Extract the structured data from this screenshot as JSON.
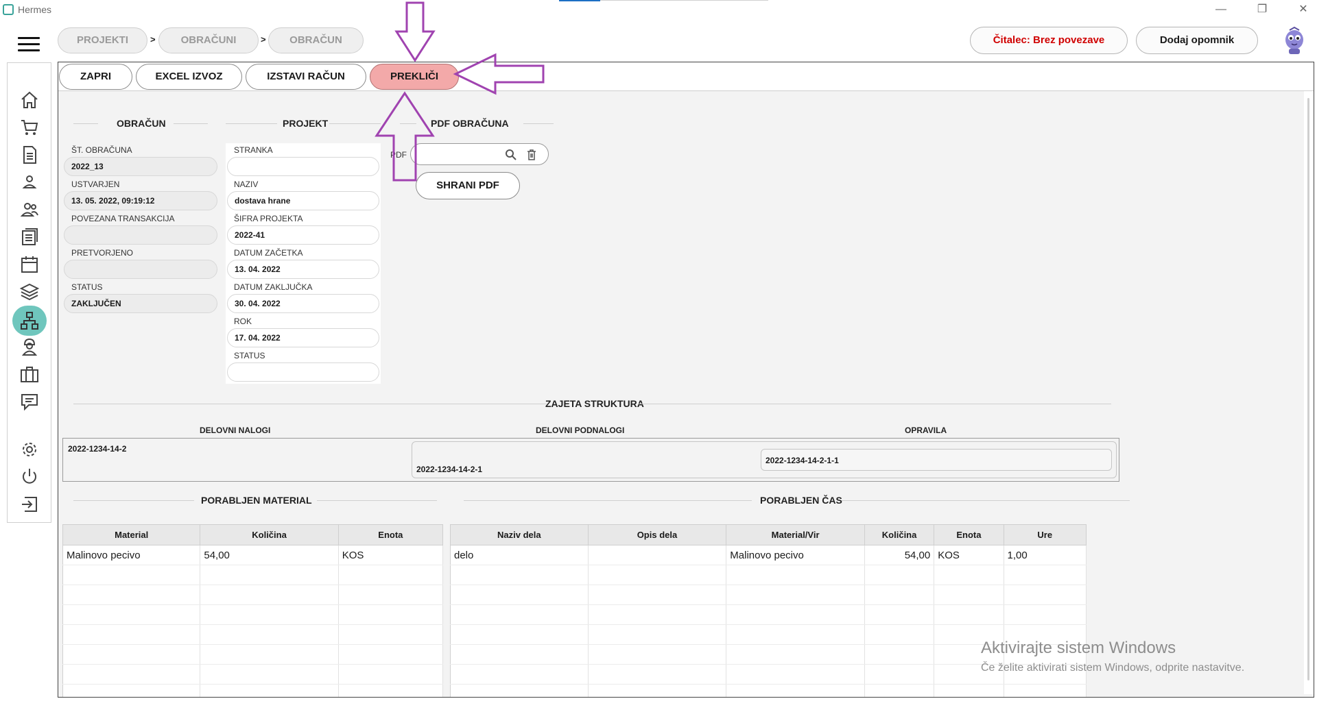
{
  "window": {
    "title": "Hermes",
    "minimize": "—",
    "maximize": "❐",
    "close": "✕"
  },
  "breadcrumbs": [
    "PROJEKTI",
    "OBRAČUNI",
    "OBRAČUN"
  ],
  "breadcrumb_sep": ">",
  "top_actions": {
    "reader_status": "Čitalec: Brez povezave",
    "add_reminder": "Dodaj opomnik"
  },
  "colors": {
    "accent": "#6fc6bd",
    "danger_button": "#f3a9a9",
    "reader_status_text": "#d00000",
    "annotation_arrow": "#a043b0"
  },
  "sidebar": {
    "items": [
      "home-icon",
      "cart-icon",
      "document-icon",
      "person-icon",
      "people-icon",
      "list-icon",
      "calendar-icon",
      "layers-icon",
      "hierarchy-icon",
      "worker-icon",
      "briefcase-icon",
      "chat-icon",
      "gear-icon",
      "power-icon",
      "logout-icon"
    ],
    "active": "hierarchy-icon"
  },
  "toolbar": {
    "close": "ZAPRI",
    "excel_export": "EXCEL IZVOZ",
    "issue_invoice": "IZSTAVI RAČUN",
    "cancel": "PREKLIČI"
  },
  "obracun": {
    "title": "OBRAČUN",
    "fields": [
      {
        "label": "ŠT. OBRAČUNA",
        "value": "2022_13"
      },
      {
        "label": "USTVARJEN",
        "value": "13. 05. 2022, 09:19:12"
      },
      {
        "label": "POVEZANA TRANSAKCIJA",
        "value": ""
      },
      {
        "label": "PRETVORJENO",
        "value": ""
      },
      {
        "label": "STATUS",
        "value": "ZAKLJUČEN"
      }
    ]
  },
  "projekt": {
    "title": "PROJEKT",
    "fields": [
      {
        "label": "STRANKA",
        "value": ""
      },
      {
        "label": "NAZIV",
        "value": "dostava hrane"
      },
      {
        "label": "ŠIFRA PROJEKTA",
        "value": "2022-41"
      },
      {
        "label": "DATUM ZAČETKA",
        "value": "13. 04. 2022"
      },
      {
        "label": "DATUM ZAKLJUČKA",
        "value": "30. 04. 2022"
      },
      {
        "label": "ROK",
        "value": "17. 04. 2022"
      },
      {
        "label": "STATUS",
        "value": ""
      }
    ]
  },
  "pdf": {
    "title": "PDF OBRAČUNA",
    "label": "PDF",
    "value": "",
    "save": "SHRANI PDF"
  },
  "struktura": {
    "title": "ZAJETA STRUKTURA",
    "col_headers": [
      "DELOVNI NALOGI",
      "DELOVNI PODNALOGI",
      "OPRAVILA"
    ],
    "nalog": "2022-1234-14-2",
    "podnalog": "2022-1234-14-2-1",
    "opravilo": "2022-1234-14-2-1-1"
  },
  "material": {
    "title": "PORABLJEN MATERIAL",
    "columns": [
      "Material",
      "Količina",
      "Enota"
    ],
    "rows": [
      [
        "Malinovo pecivo",
        "54,00",
        "KOS"
      ]
    ]
  },
  "cas": {
    "title": "PORABLJEN ČAS",
    "columns": [
      "Naziv dela",
      "Opis dela",
      "Material/Vir",
      "Količina",
      "Enota",
      "Ure"
    ],
    "rows": [
      [
        "delo",
        "",
        "Malinovo pecivo",
        "54,00",
        "KOS",
        "1,00"
      ]
    ]
  },
  "watermark": {
    "line1": "Aktivirajte sistem Windows",
    "line2": "Če želite aktivirati sistem Windows, odprite nastavitve."
  }
}
